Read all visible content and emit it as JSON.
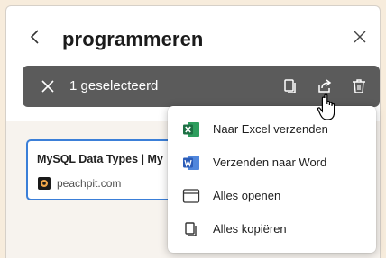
{
  "header": {
    "title": "programmeren",
    "back_icon": "chevron-left-icon",
    "close_icon": "close-icon"
  },
  "selection_bar": {
    "count_label": "1 geselecteerd",
    "clear_icon": "close-icon",
    "actions": [
      "copy-icon",
      "share-icon",
      "trash-icon"
    ]
  },
  "card": {
    "title": "MySQL Data Types | My",
    "site": "peachpit.com"
  },
  "menu": {
    "items": [
      {
        "label": "Naar Excel verzenden",
        "icon": "excel-icon"
      },
      {
        "label": "Verzenden naar Word",
        "icon": "word-icon"
      },
      {
        "label": "Alles openen",
        "icon": "window-icon"
      },
      {
        "label": "Alles kopiëren",
        "icon": "copy-icon"
      }
    ]
  },
  "colors": {
    "selection_bar": "#5b5b5b",
    "card_border": "#3b7fd8",
    "excel": "#1d7044",
    "word": "#2b5cb8",
    "background": "#f7ecdc"
  }
}
